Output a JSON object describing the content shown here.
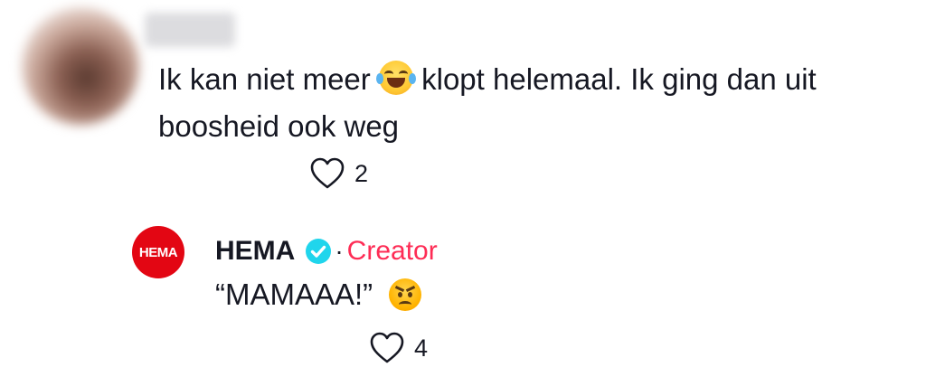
{
  "comment": {
    "text_before_emoji": "Ik kan niet meer ",
    "text_after_emoji": " klopt helemaal. Ik ging dan uit boosheid ook weg",
    "emoji": "face-with-tears-of-joy",
    "like_count": "2"
  },
  "reply": {
    "avatar_label": "HEMA",
    "author": "HEMA",
    "separator": "·",
    "creator_label": "Creator",
    "text": "“MAMAAA!”",
    "emoji": "angry-face",
    "like_count": "4"
  },
  "colors": {
    "creator": "#fe2c55",
    "verified": "#20d5ec",
    "brand_red": "#e30613",
    "text": "#161823",
    "icon": "#161823"
  },
  "icons": [
    "heart-outline-icon",
    "verified-badge-icon"
  ]
}
